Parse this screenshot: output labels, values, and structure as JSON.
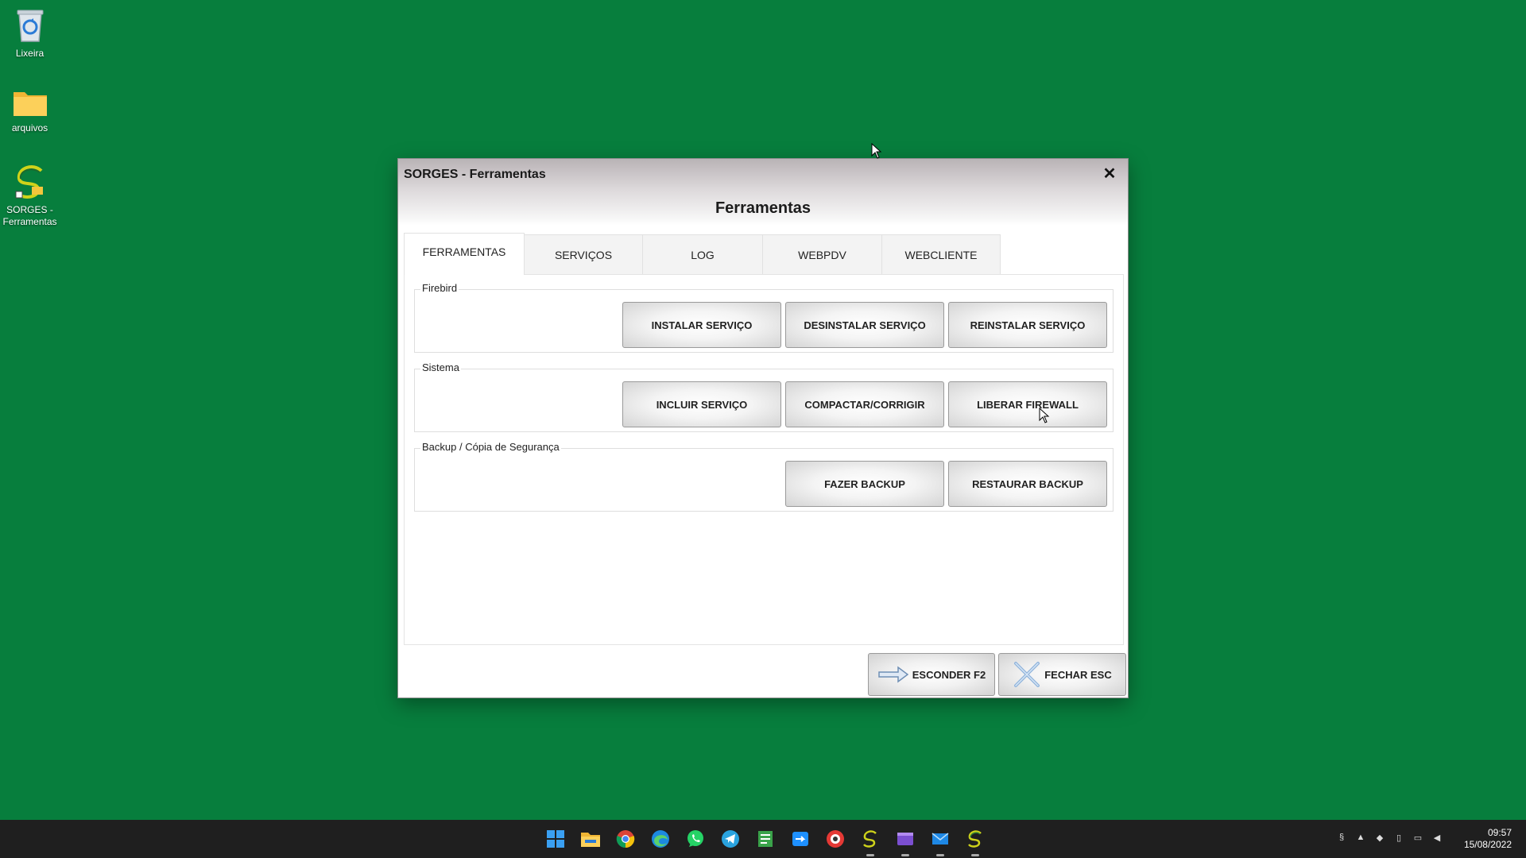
{
  "desktop": {
    "icons": [
      {
        "label": "Lixeira"
      },
      {
        "label": "arquivos"
      },
      {
        "label": "SORGES - Ferramentas"
      }
    ]
  },
  "window": {
    "title": "SORGES - Ferramentas",
    "close_glyph": "✕",
    "heading": "Ferramentas",
    "tabs": [
      {
        "label": "FERRAMENTAS",
        "active": true
      },
      {
        "label": "SERVIÇOS"
      },
      {
        "label": "LOG"
      },
      {
        "label": "WEBPDV"
      },
      {
        "label": "WEBCLIENTE"
      }
    ],
    "groups": {
      "firebird": {
        "title": "Firebird",
        "buttons": [
          "INSTALAR SERVIÇO",
          "DESINSTALAR SERVIÇO",
          "REINSTALAR SERVIÇO"
        ]
      },
      "sistema": {
        "title": "Sistema",
        "buttons": [
          "INCLUIR SERVIÇO",
          "COMPACTAR/CORRIGIR",
          "LIBERAR FIREWALL"
        ]
      },
      "backup": {
        "title": "Backup / Cópia de Segurança",
        "buttons": [
          "FAZER BACKUP",
          "RESTAURAR BACKUP"
        ]
      }
    },
    "footer": {
      "hide_label": "ESCONDER F2",
      "close_label": "FECHAR ESC"
    }
  },
  "taskbar": {
    "apps": [
      "start-icon",
      "file-explorer-icon",
      "chrome-icon",
      "edge-icon",
      "whatsapp-icon",
      "telegram-icon",
      "notepad-icon",
      "remote-icon",
      "app-icon",
      "sorges-icon",
      "media-icon",
      "mail-icon",
      "sorges-tools-icon"
    ],
    "clock": {
      "time": "09:57",
      "date": "15/08/2022"
    }
  },
  "colors": {
    "desktop_bg": "#077e3d",
    "taskbar_bg": "#1f1f1f"
  }
}
